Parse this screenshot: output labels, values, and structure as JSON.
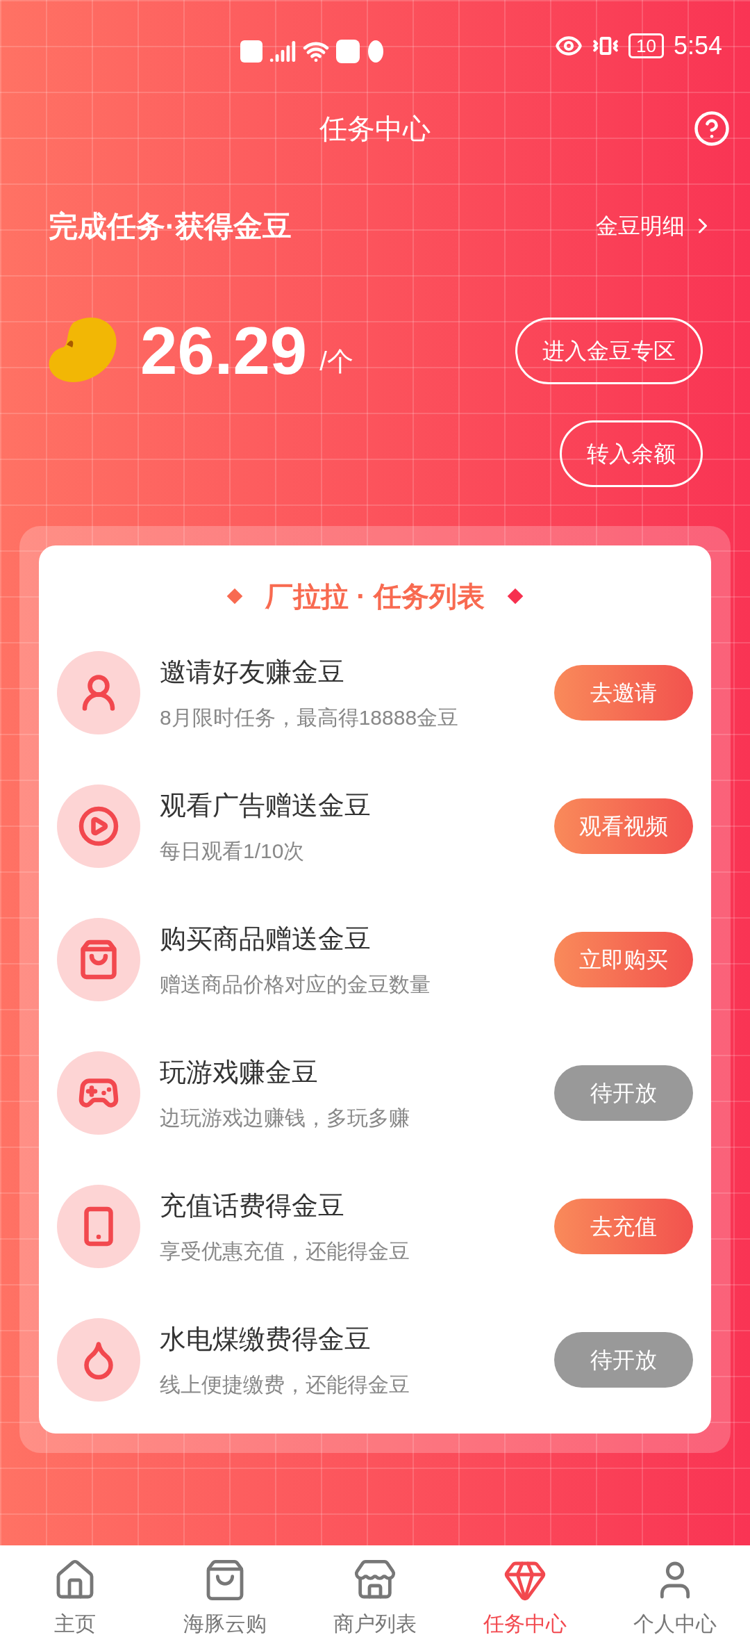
{
  "status_bar": {
    "battery": "10",
    "time": "5:54"
  },
  "header": {
    "title": "任务中心"
  },
  "banner": {
    "slogan": "完成任务·获得金豆",
    "detail_link": "金豆明细",
    "balance": "26.29",
    "unit": "/个",
    "buttons": [
      "进入金豆专区",
      "转入余额"
    ]
  },
  "task_list": {
    "title": "厂拉拉 · 任务列表",
    "tasks": [
      {
        "title": "邀请好友赚金豆",
        "subtitle": "8月限时任务，最高得18888金豆",
        "action": "去邀请",
        "available": true
      },
      {
        "title": "观看广告赠送金豆",
        "subtitle": "每日观看1/10次",
        "action": "观看视频",
        "available": true
      },
      {
        "title": "购买商品赠送金豆",
        "subtitle": "赠送商品价格对应的金豆数量",
        "action": "立即购买",
        "available": true
      },
      {
        "title": "玩游戏赚金豆",
        "subtitle": "边玩游戏边赚钱，多玩多赚",
        "action": "待开放",
        "available": false
      },
      {
        "title": "充值话费得金豆",
        "subtitle": "享受优惠充值，还能得金豆",
        "action": "去充值",
        "available": true
      },
      {
        "title": "水电煤缴费得金豆",
        "subtitle": "线上便捷缴费，还能得金豆",
        "action": "待开放",
        "available": false
      }
    ]
  },
  "bottom_nav": [
    {
      "label": "主页",
      "selected": false
    },
    {
      "label": "海豚云购",
      "selected": false
    },
    {
      "label": "商户列表",
      "selected": false
    },
    {
      "label": "任务中心",
      "selected": true
    },
    {
      "label": "个人中心",
      "selected": false
    }
  ]
}
